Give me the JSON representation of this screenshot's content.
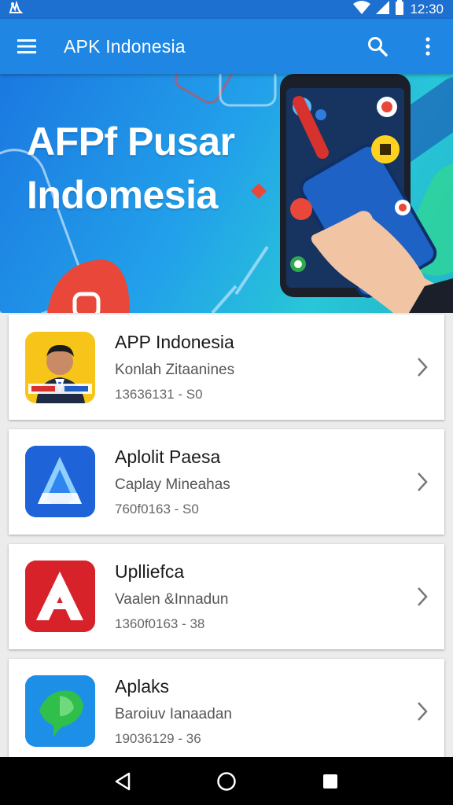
{
  "status_bar": {
    "time": "12:30",
    "left_icon": "notification-icon",
    "icons": [
      "wifi-icon",
      "signal-icon",
      "battery-icon"
    ]
  },
  "app_bar": {
    "title": "APK Indonesia",
    "icons": [
      "menu-icon",
      "search-icon",
      "more-vert-icon"
    ],
    "color": "#1f86e3"
  },
  "banner": {
    "title_line1": "AFPf Pusar",
    "title_line2": "Indomesia"
  },
  "apps": [
    {
      "title": "APP Indonesia",
      "subtitle": "Konlah Zitaanines",
      "meta": "13636131 - S0",
      "icon": "portrait-app-icon"
    },
    {
      "title": "Aplolit Paesa",
      "subtitle": "Caplay Mineahas",
      "meta": "760f0163 - S0",
      "icon": "blue-a-app-icon"
    },
    {
      "title": "Uplliefca",
      "subtitle": "Vaalen &Innadun",
      "meta": "1360f0163 - 38",
      "icon": "red-a-app-icon"
    },
    {
      "title": "Aplaks",
      "subtitle": "Baroiuv Ianaadan",
      "meta": "19036129 - 36",
      "icon": "green-bird-app-icon"
    }
  ],
  "nav_bar": {
    "icons": [
      "back-icon",
      "home-icon",
      "recents-icon"
    ]
  }
}
